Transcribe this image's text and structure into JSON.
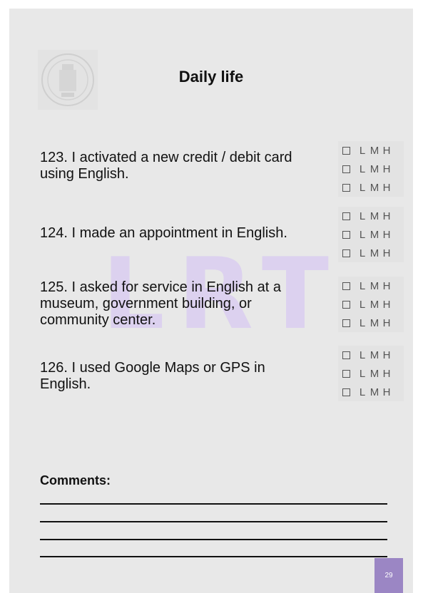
{
  "title": "Daily life",
  "watermark": "LRT",
  "questions": [
    {
      "text": "123. I activated a new credit / debit card using English."
    },
    {
      "text": "124. I made an appointment in English."
    },
    {
      "text": "125. I asked for service in English at a museum, government building, or community center."
    },
    {
      "text": "126. I used Google Maps or GPS in English."
    }
  ],
  "levels": {
    "l": "L",
    "m": "M",
    "h": "H"
  },
  "comments_label": "Comments:",
  "page_number": "29",
  "colors": {
    "accent": "#9b86c4",
    "watermark": "#dcd1ef",
    "page_bg": "#e8e8e8"
  },
  "icons": {
    "seal": "university-seal-icon",
    "checkbox": "checkbox-icon"
  }
}
